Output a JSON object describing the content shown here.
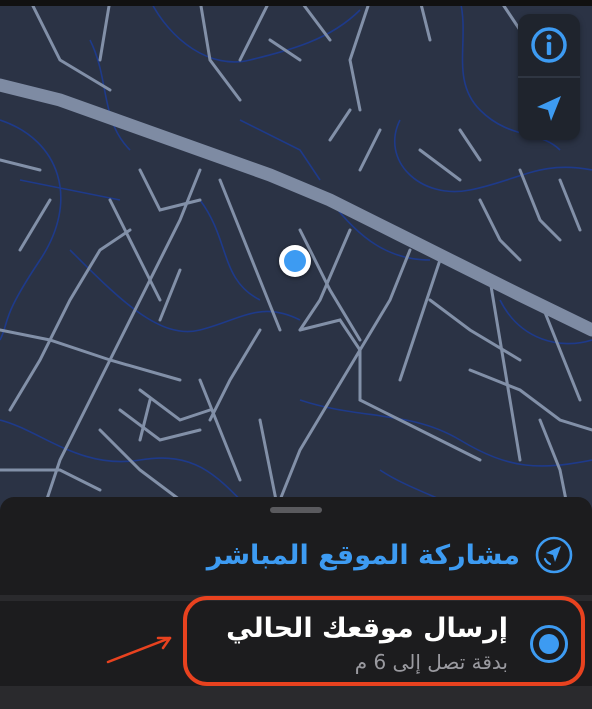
{
  "map": {
    "info_icon": "info-icon",
    "locate_icon": "location-arrow-icon",
    "accent_color": "#3d9bf2"
  },
  "sheet": {
    "title": "مشاركة الموقع المباشر",
    "header_icon": "live-location-icon"
  },
  "option": {
    "title": "إرسال موقعك الحالي",
    "subtitle": "بدقة تصل إلى 6 م",
    "selected": true
  },
  "annotation": {
    "highlight_color": "#e8421f",
    "arrow_icon": "arrow-icon"
  }
}
